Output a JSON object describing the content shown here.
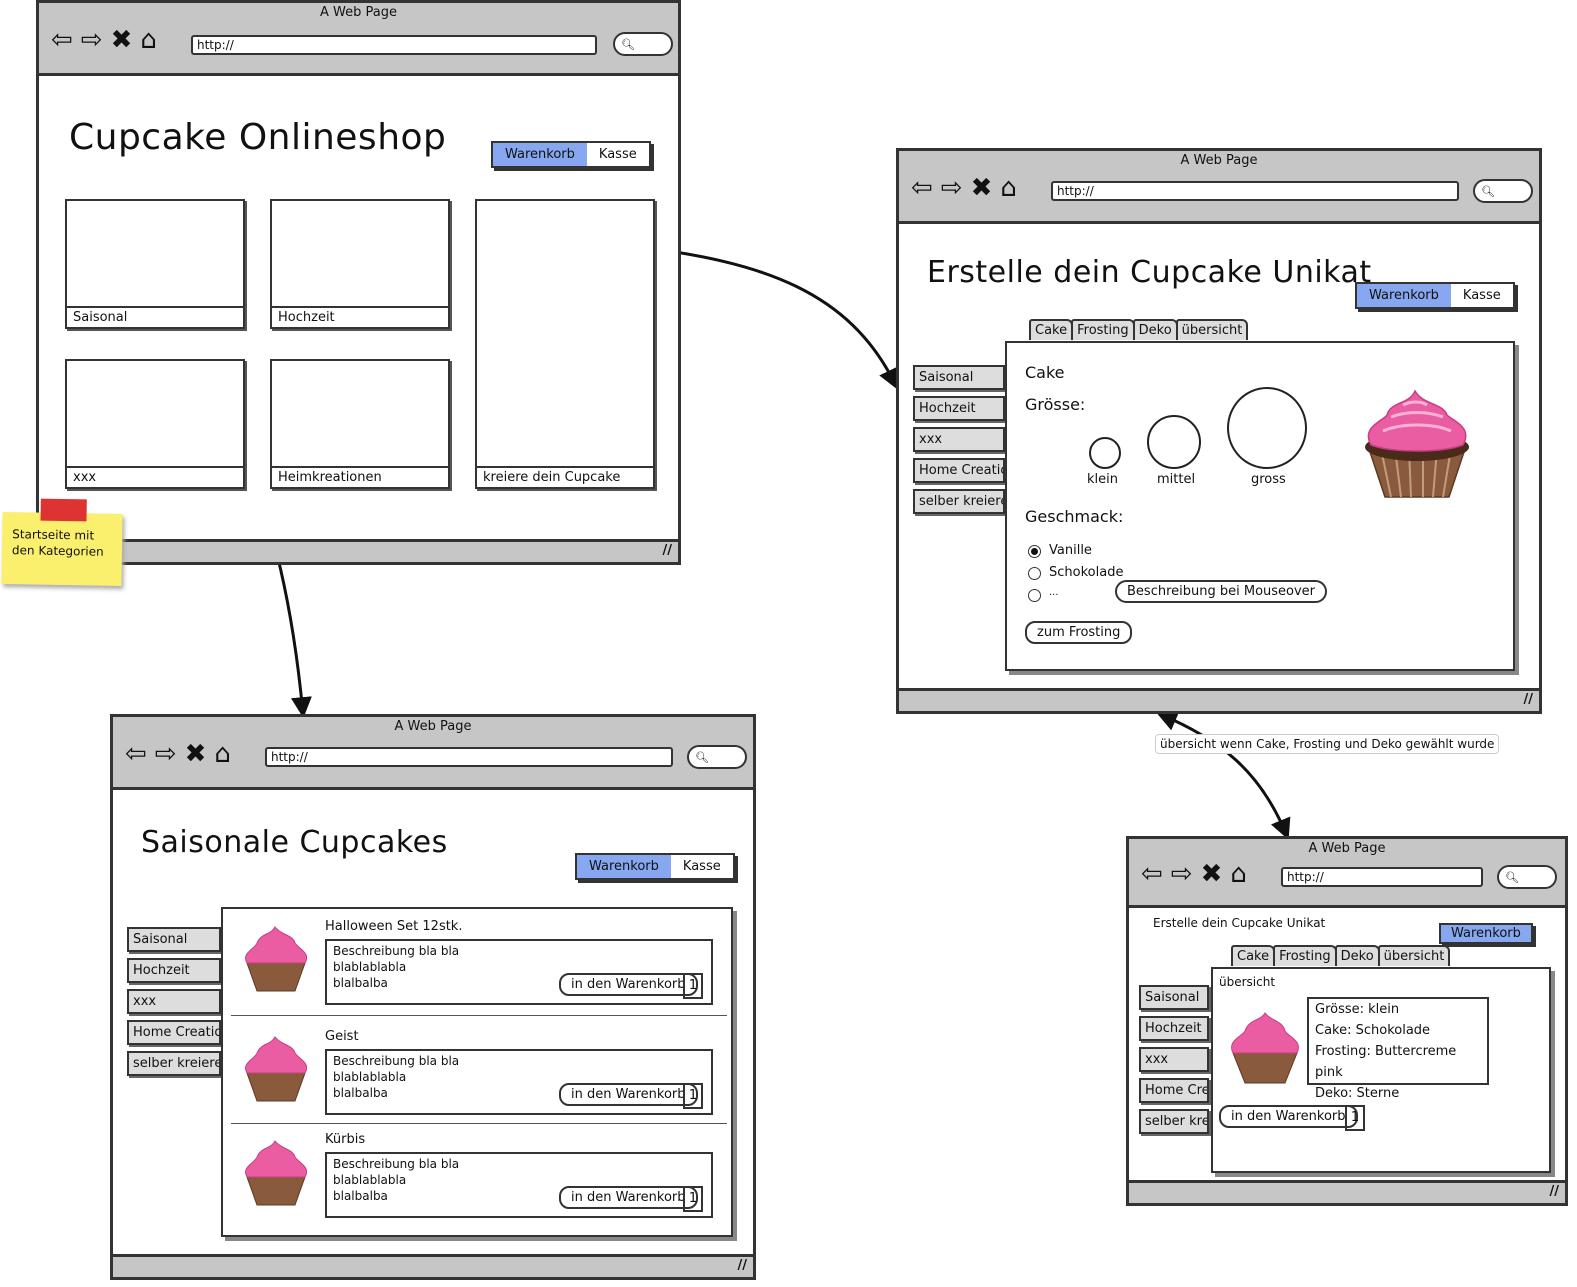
{
  "window_title": "A Web Page",
  "url_text": "http://",
  "buttons": {
    "cart": "Warenkorb",
    "checkout": "Kasse",
    "add_to_cart": "in den Warenkorb"
  },
  "home": {
    "title": "Cupcake Onlineshop",
    "tiles": [
      "Saisonal",
      "Hochzeit",
      "xxx",
      "Heimkreationen",
      "kreiere dein Cupcake"
    ]
  },
  "sticky_note": "Startseite mit den Kategorien",
  "creator": {
    "title": "Erstelle dein Cupcake Unikat",
    "tabs": [
      "Cake",
      "Frosting",
      "Deko",
      "übersicht"
    ],
    "sidebar": [
      "Saisonal",
      "Hochzeit",
      "xxx",
      "Home Creation",
      "selber kreieren"
    ],
    "section": "Cake",
    "size_label": "Grösse:",
    "sizes": [
      "klein",
      "mittel",
      "gross"
    ],
    "taste_label": "Geschmack:",
    "tastes": [
      "Vanille",
      "Schokolade",
      "..."
    ],
    "tooltip": "Beschreibung bei Mouseover",
    "next_button": "zum Frosting"
  },
  "seasonal": {
    "title": "Saisonale Cupcakes",
    "sidebar": [
      "Saisonal",
      "Hochzeit",
      "xxx",
      "Home Creation",
      "selber kreieren"
    ],
    "products": [
      {
        "name": "Halloween Set 12stk.",
        "desc": [
          "Beschreibung bla bla",
          "blablablabla",
          "blalbalba"
        ],
        "qty": "1"
      },
      {
        "name": "Geist",
        "desc": [
          "Beschreibung bla bla",
          "blablablabla",
          "blalbalba"
        ],
        "qty": "1"
      },
      {
        "name": "Kürbis",
        "desc": [
          "Beschreibung bla bla",
          "blablablabla",
          "blalbalba"
        ],
        "qty": "1"
      }
    ]
  },
  "annotation": "übersicht wenn Cake, Frosting und Deko gewählt wurde",
  "summary": {
    "title": "Erstelle dein Cupcake Unikat",
    "tabs": [
      "Cake",
      "Frosting",
      "Deko",
      "übersicht"
    ],
    "sidebar": [
      "Saisonal",
      "Hochzeit",
      "xxx",
      "Home Creat",
      "selber kreie"
    ],
    "section": "übersicht",
    "details": [
      "Grösse: klein",
      "Cake: Schokolade",
      "Frosting: Buttercreme pink",
      "Deko: Sterne"
    ],
    "qty": "1"
  }
}
